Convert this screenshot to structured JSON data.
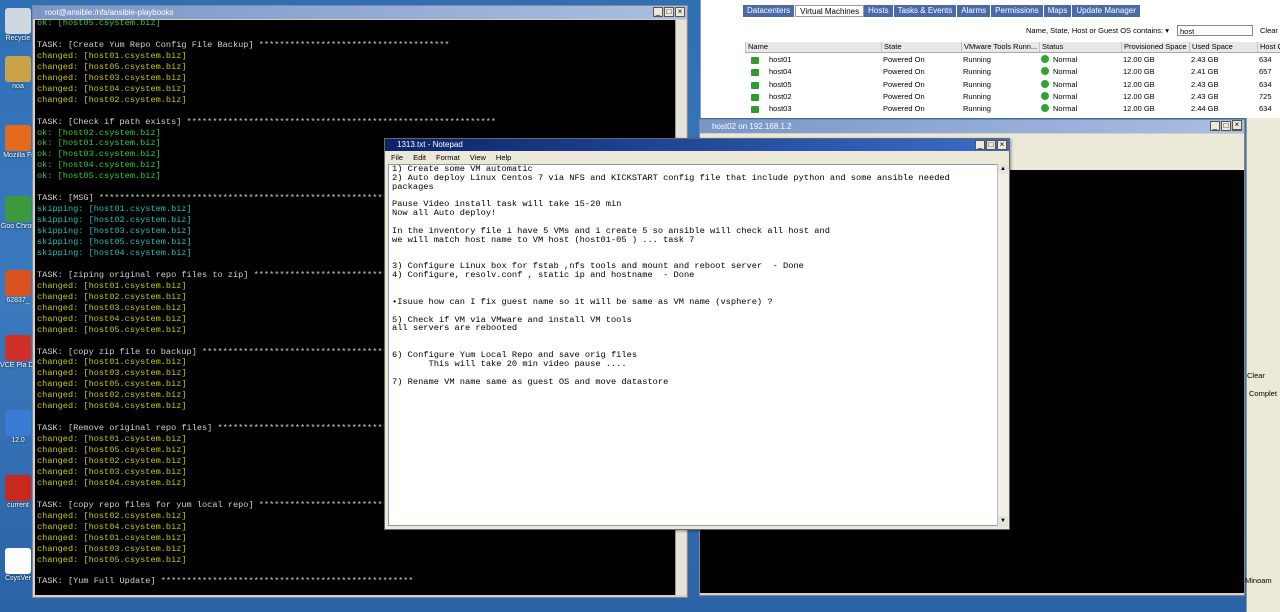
{
  "desktop": {
    "icons": [
      {
        "label": "Recycle",
        "color": "#cfd8e0"
      },
      {
        "label": "noa",
        "color": "#c9a24a"
      },
      {
        "label": "Mozilla Fi",
        "color": "#e66a1c"
      },
      {
        "label": "Goo Chron",
        "color": "#3c9a3c"
      },
      {
        "label": "62837_",
        "color": "#d9521f"
      },
      {
        "label": "VCE Pla Dem",
        "color": "#d0302a"
      },
      {
        "label": "12.0",
        "color": "#3a7bd5"
      },
      {
        "label": "current",
        "color": "#c8281e"
      },
      {
        "label": "CsysVer",
        "color": "#ffffff"
      }
    ]
  },
  "terminal": {
    "title": "root@ansible:/nfs/ansible-playbooks",
    "lines": [
      {
        "t": "ok",
        "text": "ok: [host05.csystem.biz]"
      },
      {
        "t": "blank",
        "text": ""
      },
      {
        "t": "task",
        "text": "TASK: [Create Yum Repo Config File Backup] *************************************"
      },
      {
        "t": "changed",
        "text": "changed: [host01.csystem.biz]"
      },
      {
        "t": "changed",
        "text": "changed: [host05.csystem.biz]"
      },
      {
        "t": "changed",
        "text": "changed: [host03.csystem.biz]"
      },
      {
        "t": "changed",
        "text": "changed: [host04.csystem.biz]"
      },
      {
        "t": "changed",
        "text": "changed: [host02.csystem.biz]"
      },
      {
        "t": "blank",
        "text": ""
      },
      {
        "t": "task",
        "text": "TASK: [Check if path exists] ************************************************************"
      },
      {
        "t": "ok",
        "text": "ok: [host02.csystem.biz]"
      },
      {
        "t": "ok",
        "text": "ok: [host01.csystem.biz]"
      },
      {
        "t": "ok",
        "text": "ok: [host03.csystem.biz]"
      },
      {
        "t": "ok",
        "text": "ok: [host04.csystem.biz]"
      },
      {
        "t": "ok",
        "text": "ok: [host05.csystem.biz]"
      },
      {
        "t": "blank",
        "text": ""
      },
      {
        "t": "task",
        "text": "TASK: [MSG] *************************************************************************"
      },
      {
        "t": "skip",
        "text": "skipping: [host01.csystem.biz]"
      },
      {
        "t": "skip",
        "text": "skipping: [host02.csystem.biz]"
      },
      {
        "t": "skip",
        "text": "skipping: [host03.csystem.biz]"
      },
      {
        "t": "skip",
        "text": "skipping: [host05.csystem.biz]"
      },
      {
        "t": "skip",
        "text": "skipping: [host04.csystem.biz]"
      },
      {
        "t": "blank",
        "text": ""
      },
      {
        "t": "task",
        "text": "TASK: [ziping original repo files to zip] *********************************************"
      },
      {
        "t": "changed",
        "text": "changed: [host01.csystem.biz]"
      },
      {
        "t": "changed",
        "text": "changed: [host02.csystem.biz]"
      },
      {
        "t": "changed",
        "text": "changed: [host03.csystem.biz]"
      },
      {
        "t": "changed",
        "text": "changed: [host04.csystem.biz]"
      },
      {
        "t": "changed",
        "text": "changed: [host05.csystem.biz]"
      },
      {
        "t": "blank",
        "text": ""
      },
      {
        "t": "task",
        "text": "TASK: [copy zip file to backup] ***********************************************************"
      },
      {
        "t": "changed",
        "text": "changed: [host01.csystem.biz]"
      },
      {
        "t": "changed",
        "text": "changed: [host03.csystem.biz]"
      },
      {
        "t": "changed",
        "text": "changed: [host05.csystem.biz]"
      },
      {
        "t": "changed",
        "text": "changed: [host02.csystem.biz]"
      },
      {
        "t": "changed",
        "text": "changed: [host04.csystem.biz]"
      },
      {
        "t": "blank",
        "text": ""
      },
      {
        "t": "task",
        "text": "TASK: [Remove original repo files] *******************************************************"
      },
      {
        "t": "changed",
        "text": "changed: [host01.csystem.biz]"
      },
      {
        "t": "changed",
        "text": "changed: [host05.csystem.biz]"
      },
      {
        "t": "changed",
        "text": "changed: [host02.csystem.biz]"
      },
      {
        "t": "changed",
        "text": "changed: [host03.csystem.biz]"
      },
      {
        "t": "changed",
        "text": "changed: [host04.csystem.biz]"
      },
      {
        "t": "blank",
        "text": ""
      },
      {
        "t": "task",
        "text": "TASK: [copy repo files for yum local repo] **********************************************"
      },
      {
        "t": "changed",
        "text": "changed: [host02.csystem.biz]"
      },
      {
        "t": "changed",
        "text": "changed: [host04.csystem.biz]"
      },
      {
        "t": "changed",
        "text": "changed: [host01.csystem.biz]"
      },
      {
        "t": "changed",
        "text": "changed: [host03.csystem.biz]"
      },
      {
        "t": "changed",
        "text": "changed: [host05.csystem.biz]"
      },
      {
        "t": "blank",
        "text": ""
      },
      {
        "t": "task",
        "text": "TASK: [Yum Full Update] *************************************************"
      }
    ]
  },
  "vsphere": {
    "tabs": [
      "Datacenters",
      "Virtual Machines",
      "Hosts",
      "Tasks & Events",
      "Alarms",
      "Permissions",
      "Maps",
      "Update Manager"
    ],
    "active_tab": 1,
    "filter_label": "Name, State, Host or Guest OS contains: ▾",
    "filter_value": "host",
    "clear_label": "Clear",
    "columns": [
      "Name",
      "State",
      "VMware Tools Runn...",
      "Status",
      "Provisioned Space",
      "Used Space",
      "Host C"
    ],
    "rows": [
      [
        "host01",
        "Powered On",
        "Running",
        "Normal",
        "12.00 GB",
        "2.43 GB",
        "634"
      ],
      [
        "host04",
        "Powered On",
        "Running",
        "Normal",
        "12.00 GB",
        "2.41 GB",
        "657"
      ],
      [
        "host05",
        "Powered On",
        "Running",
        "Normal",
        "12.00 GB",
        "2.43 GB",
        "634"
      ],
      [
        "host02",
        "Powered On",
        "Running",
        "Normal",
        "12.00 GB",
        "2.43 GB",
        "725"
      ],
      [
        "host03",
        "Powered On",
        "Running",
        "Normal",
        "12.00 GB",
        "2.44 GB",
        "634"
      ]
    ]
  },
  "console": {
    "title": "host02 on 192.168.1.2"
  },
  "right_panel": {
    "clear": "Clear",
    "complete": "Complet",
    "minimize": "Minoam"
  },
  "notepad": {
    "title": "1313.txt - Notepad",
    "menu": [
      "File",
      "Edit",
      "Format",
      "View",
      "Help"
    ],
    "lines": [
      "1) Create some VM automatic",
      "2) Auto deploy Linux Centos 7 via NFS and KICKSTART config file that include python and some ansible needed",
      "packages",
      "",
      "Pause Video install task will take 15-20 min",
      "Now all Auto deploy!",
      "",
      "In the inventory file i have 5 VMs and i create 5 so ansible will check all host and",
      "we will match host name to VM host (host01-05 ) ... task 7",
      "",
      "",
      "3) Configure Linux box for fstab ,nfs tools and mount and reboot server  - Done",
      "4) Configure, resolv.conf , static ip and hostname  - Done",
      "",
      "",
      "•Isuue how can I fix guest name so it will be same as VM name (vsphere) ?",
      "",
      "5) Check if VM via VMware and install VM tools",
      "all servers are rebooted",
      "",
      "",
      "6) Configure Yum Local Repo and save orig files",
      "       This will take 20 min video pause ....",
      "",
      "7) Rename VM name same as guest OS and move datastore"
    ]
  }
}
